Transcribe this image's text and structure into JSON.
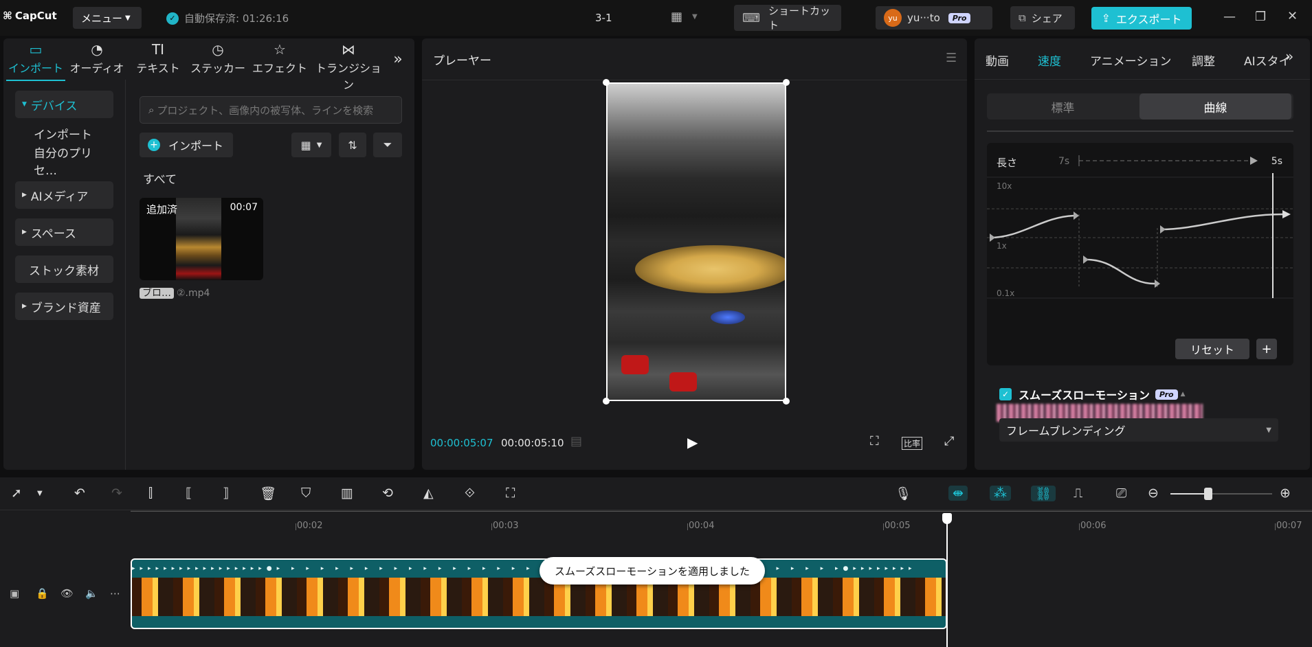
{
  "titlebar": {
    "logo": "CapCut",
    "menu_label": "メニュー",
    "autosave": "自動保存済: 01:26:16",
    "project_name": "3-1",
    "shortcut_label": "ショートカット",
    "user_initials": "yu",
    "user_name": "yu···to",
    "pro_badge": "Pro",
    "share_label": "シェア",
    "export_label": "エクスポート"
  },
  "tool_tabs": [
    {
      "label": "インポート",
      "icon": "import-icon"
    },
    {
      "label": "オーディオ",
      "icon": "audio-icon"
    },
    {
      "label": "テキスト",
      "icon": "text-icon"
    },
    {
      "label": "ステッカー",
      "icon": "sticker-icon"
    },
    {
      "label": "エフェクト",
      "icon": "effect-icon"
    },
    {
      "label": "トランジション",
      "icon": "transition-icon"
    }
  ],
  "sidebar": {
    "items": [
      {
        "label": "デバイス"
      },
      {
        "label": "インポート"
      },
      {
        "label": "自分のプリセ…"
      },
      {
        "label": "AIメディア"
      },
      {
        "label": "スペース"
      },
      {
        "label": "ストック素材"
      },
      {
        "label": "ブランド資産"
      }
    ]
  },
  "media": {
    "search_placeholder": "プロジェクト、画像内の被写体、ラインを検索",
    "import_label": "インポート",
    "section_label": "すべて",
    "clip": {
      "added_label": "追加済",
      "duration": "00:07",
      "tag": "ブロ…",
      "filename": "②.mp4"
    }
  },
  "player": {
    "title": "プレーヤー",
    "current_time": "00:00:05:07",
    "total_time": "00:00:05:10",
    "ratio_label": "比率"
  },
  "right_panel": {
    "tabs": [
      "動画",
      "速度",
      "アニメーション",
      "調整",
      "AIスタイ"
    ],
    "segment": {
      "off": "標準",
      "on": "曲線"
    },
    "curve": {
      "length_label": "長さ",
      "from": "7s",
      "to": "5s",
      "y_top": "10x",
      "y_mid": "1x",
      "y_bot": "0.1x",
      "reset_label": "リセット"
    },
    "smooth_label": "スムーズスローモーション",
    "smooth_pro": "Pro",
    "frame_mode": "フレームブレンディング"
  },
  "timeline": {
    "ticks": [
      "00:02",
      "00:03",
      "00:04",
      "00:05",
      "00:06",
      "00:07"
    ],
    "toast": "スムーズスローモーションを適用しました",
    "zoom_level": 0.37
  },
  "colors": {
    "accent": "#1ec0d2",
    "clip": "#0e5f66"
  }
}
